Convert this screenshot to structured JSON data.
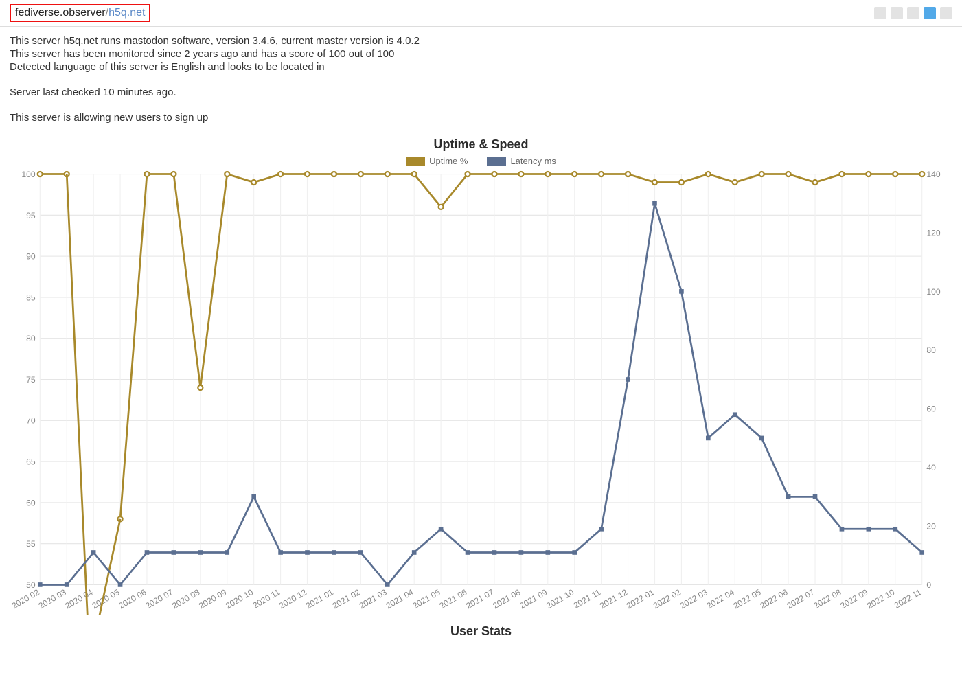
{
  "breadcrumb": {
    "root": "fediverse.observer",
    "sep": "/",
    "leaf": "h5q.net"
  },
  "info": {
    "l1": "This server h5q.net runs mastodon software, version 3.4.6, current master version is 4.0.2",
    "l2": "This server has been monitored since 2 years ago and has a score of 100 out of 100",
    "l3": "Detected language of this server is English and looks to be located in",
    "l4": "Server last checked 10 minutes ago.",
    "l5": "This server is allowing new users to sign up"
  },
  "chart": {
    "title": "Uptime & Speed",
    "legend": {
      "uptime": "Uptime %",
      "latency": "Latency ms"
    },
    "yLeftTicks": [
      50,
      55,
      60,
      65,
      70,
      75,
      80,
      85,
      90,
      95,
      100
    ],
    "yRightTicks": [
      0,
      20,
      40,
      60,
      80,
      100,
      120,
      140
    ]
  },
  "next_chart_title": "User Stats",
  "chart_data": {
    "type": "line",
    "title": "Uptime & Speed",
    "xlabel": "",
    "ylabel_left": "Uptime %",
    "ylabel_right": "Latency ms",
    "ylim_left": [
      50,
      100
    ],
    "ylim_right": [
      0,
      140
    ],
    "categories": [
      "2020 02",
      "2020 03",
      "2020 04",
      "2020 05",
      "2020 06",
      "2020 07",
      "2020 08",
      "2020 09",
      "2020 10",
      "2020 11",
      "2020 12",
      "2021 01",
      "2021 02",
      "2021 03",
      "2021 04",
      "2021 05",
      "2021 06",
      "2021 07",
      "2021 08",
      "2021 09",
      "2021 10",
      "2021 11",
      "2021 12",
      "2022 01",
      "2022 02",
      "2022 03",
      "2022 04",
      "2022 05",
      "2022 06",
      "2022 07",
      "2022 08",
      "2022 09",
      "2022 10",
      "2022 11"
    ],
    "series": [
      {
        "name": "Uptime %",
        "axis": "left",
        "values": [
          100,
          100,
          null,
          58,
          100,
          100,
          74,
          100,
          99,
          100,
          100,
          100,
          100,
          100,
          100,
          96,
          100,
          100,
          100,
          100,
          100,
          100,
          100,
          99,
          99,
          100,
          99,
          100,
          100,
          99,
          100,
          100,
          100,
          100
        ]
      },
      {
        "name": "Latency ms",
        "axis": "right",
        "values": [
          0,
          0,
          11,
          0,
          11,
          11,
          11,
          11,
          30,
          11,
          11,
          11,
          11,
          0,
          11,
          19,
          11,
          11,
          11,
          11,
          11,
          19,
          70,
          130,
          100,
          50,
          58,
          50,
          30,
          30,
          19,
          19,
          19,
          11
        ]
      }
    ]
  }
}
